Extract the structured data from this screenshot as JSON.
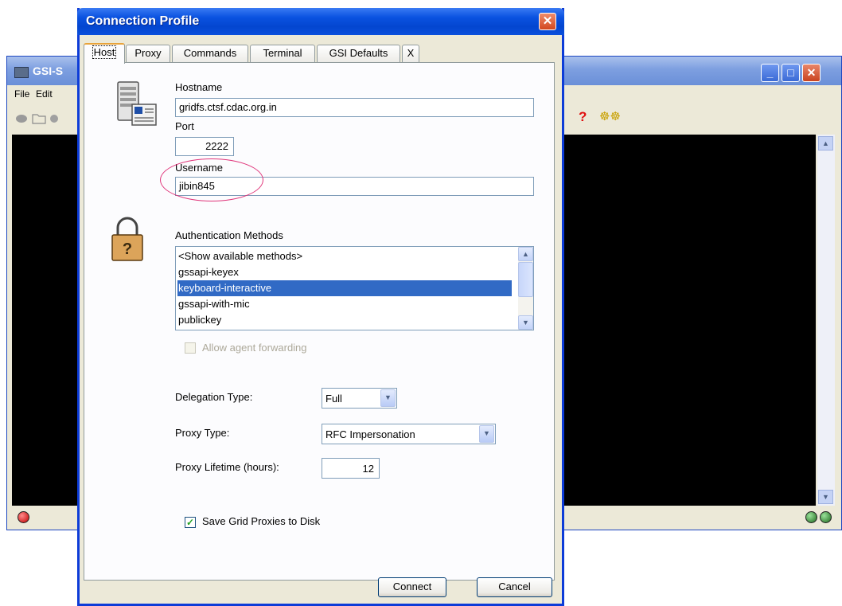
{
  "background_window": {
    "title": "GSI-S",
    "menu": [
      "File",
      "Edit"
    ],
    "toolbar_right_glyphs": [
      "?",
      "☸☸"
    ]
  },
  "dialog": {
    "title": "Connection Profile",
    "tabs": [
      "Host",
      "Proxy",
      "Commands",
      "Terminal",
      "GSI Defaults",
      "X"
    ],
    "active_tab": "Host",
    "host": {
      "hostname_label": "Hostname",
      "hostname_value": "gridfs.ctsf.cdac.org.in",
      "port_label": "Port",
      "port_value": "2222",
      "username_label": "Username",
      "username_value": "jibin845"
    },
    "auth": {
      "label": "Authentication Methods",
      "methods": [
        "<Show available methods>",
        "gssapi-keyex",
        "keyboard-interactive",
        "gssapi-with-mic",
        "publickey"
      ],
      "selected": "keyboard-interactive",
      "agent_forwarding_label": "Allow agent forwarding"
    },
    "delegation": {
      "label": "Delegation Type:",
      "value": "Full"
    },
    "proxy_type": {
      "label": "Proxy Type:",
      "value": "RFC Impersonation"
    },
    "proxy_lifetime": {
      "label": "Proxy Lifetime (hours):",
      "value": "12"
    },
    "save_proxies": {
      "label": "Save Grid Proxies to Disk",
      "checked": true
    },
    "buttons": {
      "connect": "Connect",
      "cancel": "Cancel"
    }
  },
  "colors": {
    "title_bar": "#0a52e0",
    "selection": "#316ac5",
    "annotation_circle": "#e0357a",
    "terminal": "#000000"
  }
}
